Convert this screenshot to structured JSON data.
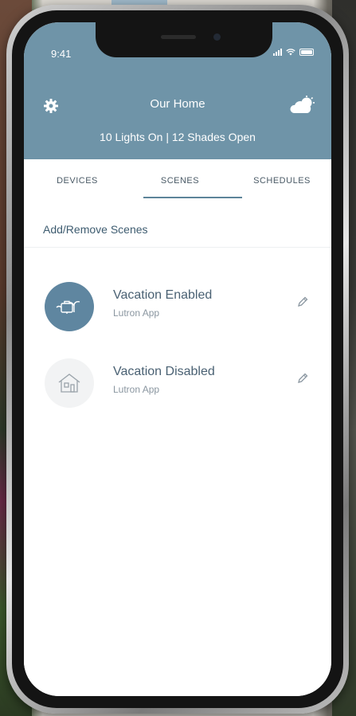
{
  "status": {
    "time": "9:41"
  },
  "header": {
    "title": "Our Home",
    "summary": "10 Lights On | 12 Shades Open"
  },
  "tabs": [
    {
      "label": "DEVICES"
    },
    {
      "label": "SCENES"
    },
    {
      "label": "SCHEDULES"
    }
  ],
  "active_tab": "SCENES",
  "content": {
    "add_remove_label": "Add/Remove Scenes",
    "scenes": [
      {
        "name": "Vacation Enabled",
        "source": "Lutron App",
        "icon": "vacation-icon",
        "active": true
      },
      {
        "name": "Vacation Disabled",
        "source": "Lutron App",
        "icon": "home-icon",
        "active": false
      }
    ]
  },
  "colors": {
    "header": "#6f94a8",
    "accent": "#5d8499",
    "active_scene": "#5f86a0",
    "text_primary": "#4a6173"
  },
  "icons": {
    "settings": "gear-icon",
    "weather": "cloud-sun-icon",
    "edit": "pencil-icon"
  }
}
